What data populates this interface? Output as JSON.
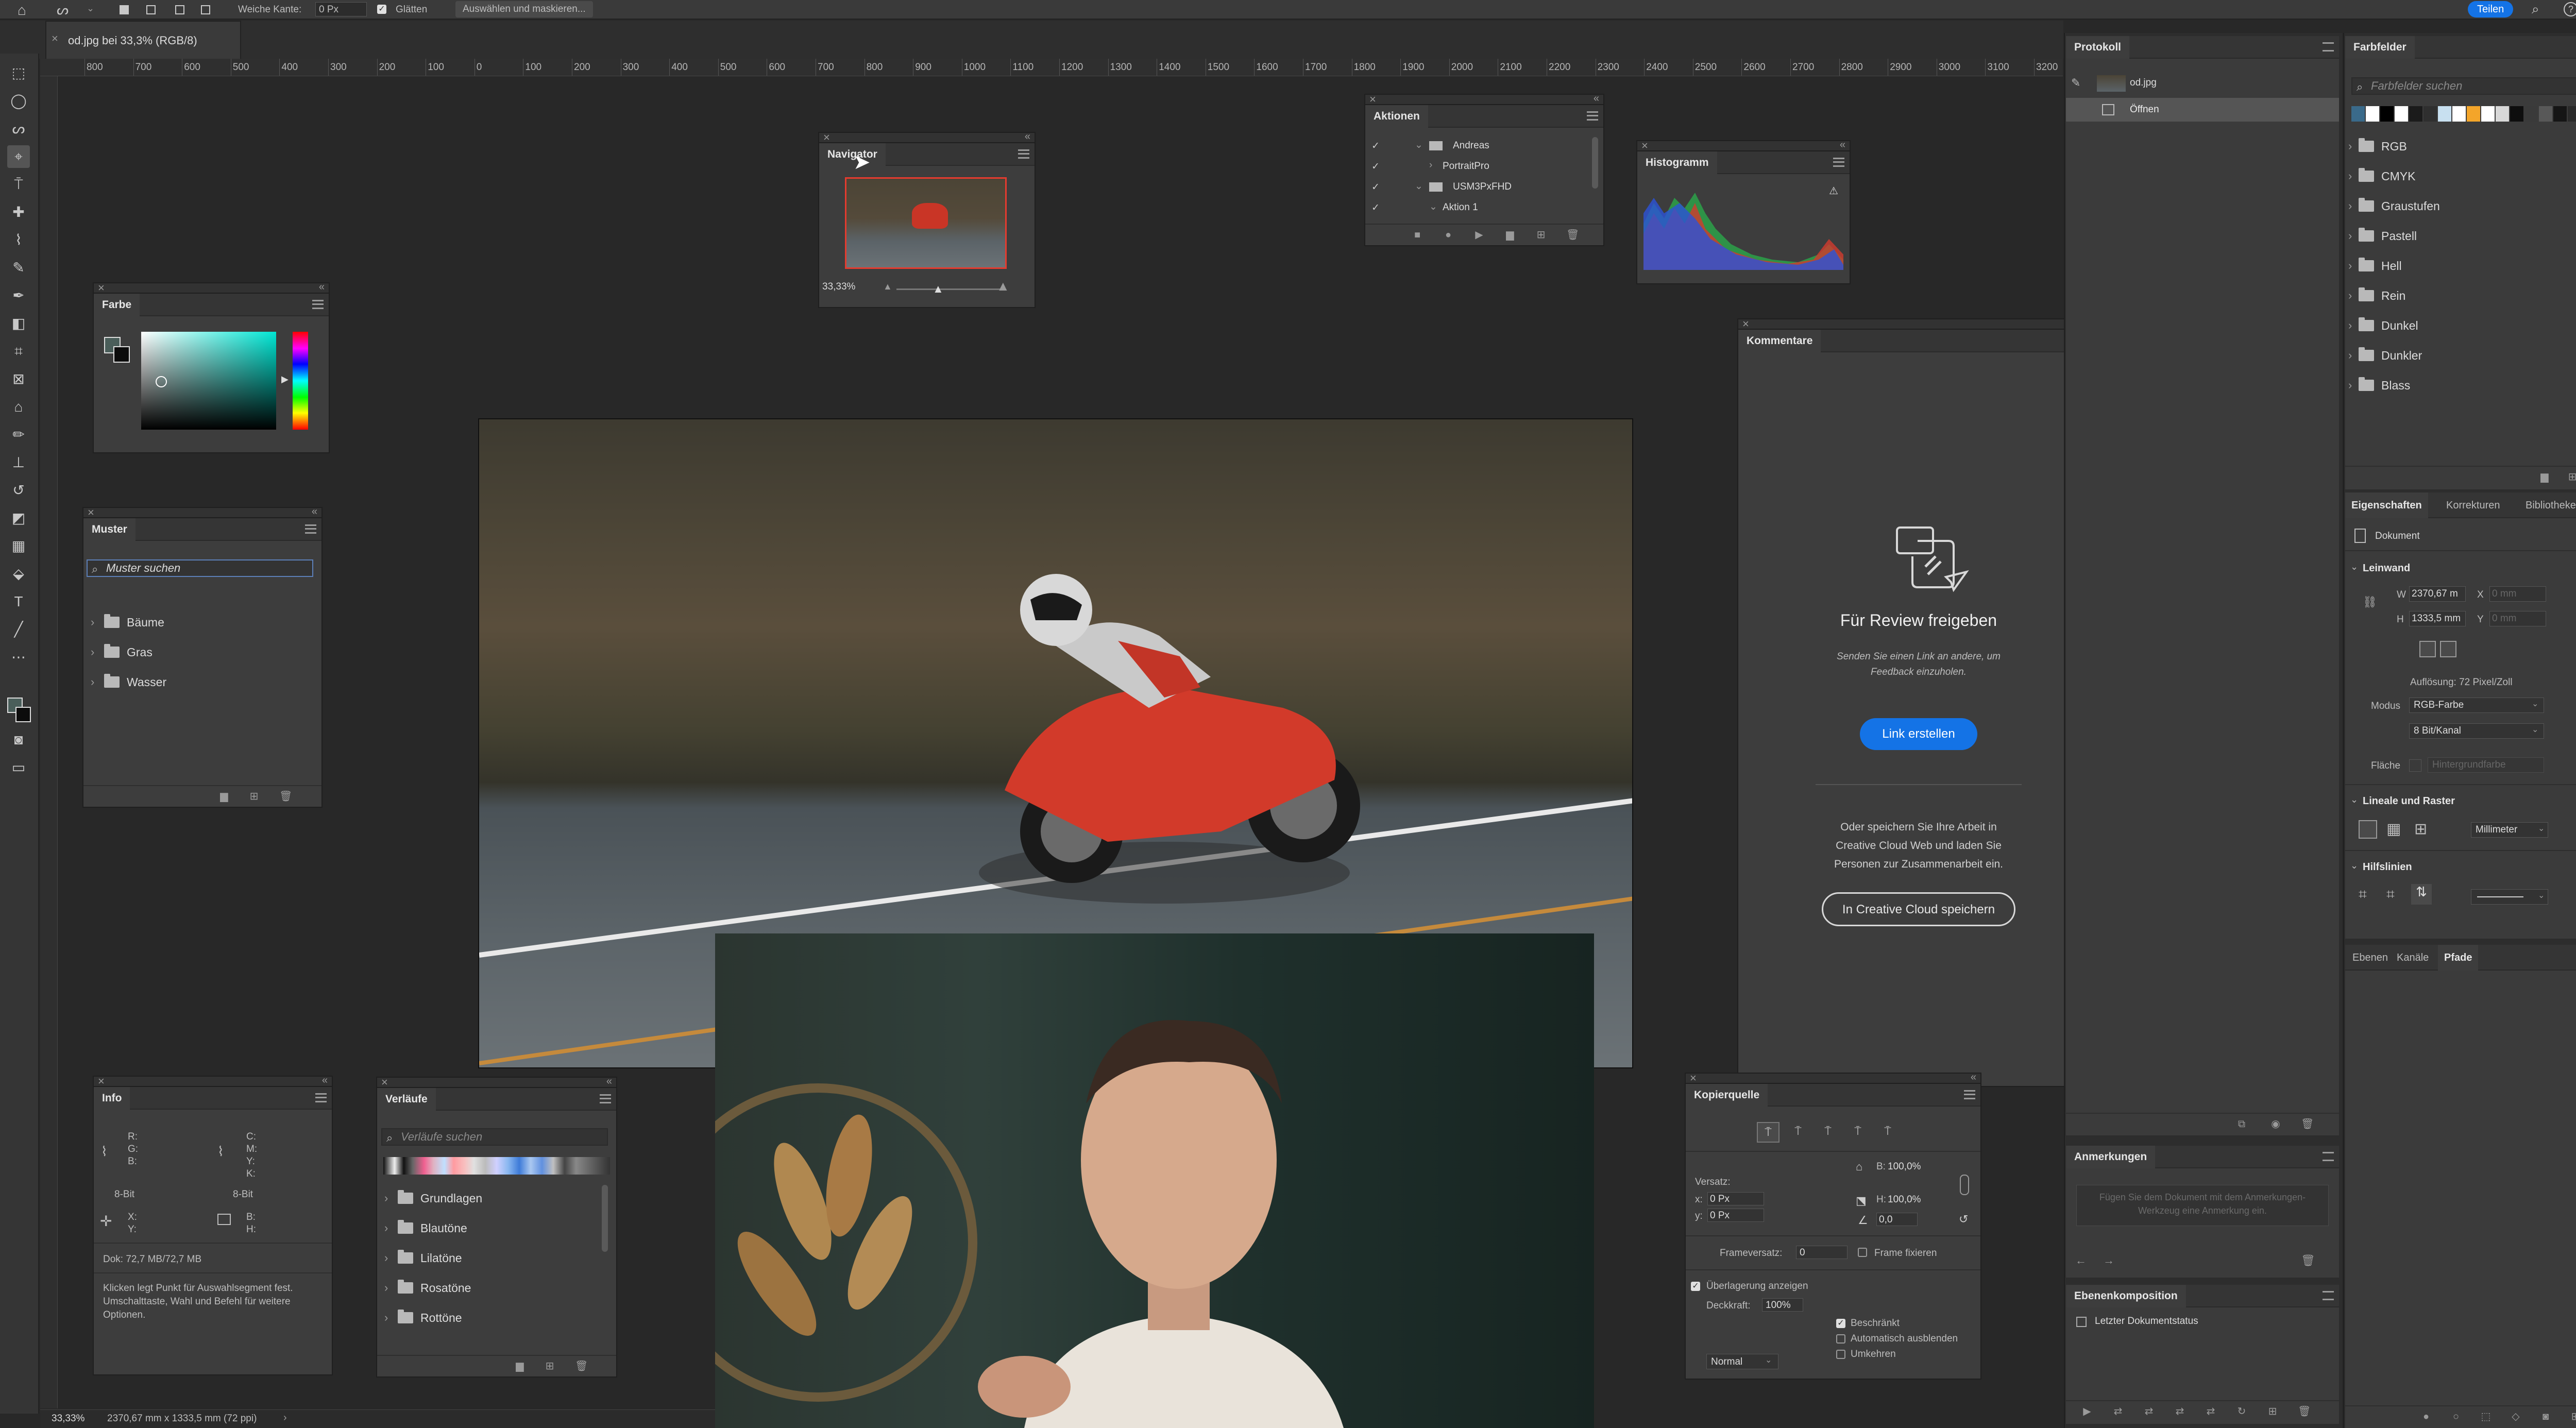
{
  "options_bar": {
    "feather_label": "Weiche Kante:",
    "feather_value": "0 Px",
    "smooth_label": "Glätten",
    "select_mask_button": "Auswählen und maskieren...",
    "share_button": "Teilen"
  },
  "document_tab": {
    "title": "od.jpg bei 33,3% (RGB/8)"
  },
  "ruler": {
    "ticks": [
      "800",
      "700",
      "600",
      "500",
      "400",
      "300",
      "200",
      "100",
      "0",
      "100",
      "200",
      "300",
      "400",
      "500",
      "600",
      "700",
      "800",
      "900",
      "1000",
      "1100",
      "1200",
      "1300",
      "1400",
      "1500",
      "1600",
      "1700",
      "1800",
      "1900",
      "2000",
      "2100",
      "2200",
      "2300",
      "2400",
      "2500",
      "2600",
      "2700",
      "2800",
      "2900",
      "3000",
      "3100",
      "3200"
    ]
  },
  "navigator": {
    "title": "Navigator",
    "zoom": "33,33%"
  },
  "actions": {
    "title": "Aktionen",
    "items": [
      "Andreas",
      "PortraitPro",
      "USM3PxFHD",
      "Aktion 1"
    ]
  },
  "histogram": {
    "title": "Histogramm"
  },
  "color_panel": {
    "title": "Farbe"
  },
  "patterns": {
    "title": "Muster",
    "search_placeholder": "Muster suchen",
    "folders": [
      "Bäume",
      "Gras",
      "Wasser"
    ]
  },
  "comments": {
    "title": "Kommentare",
    "heading": "Für Review freigeben",
    "description": "Senden Sie einen Link an andere, um Feedback einzuholen.",
    "create_link_button": "Link erstellen",
    "alt_text": "Oder speichern Sie Ihre Arbeit in Creative Cloud Web und laden Sie Personen zur Zusammenarbeit ein.",
    "save_cc_button": "In Creative Cloud speichern"
  },
  "info": {
    "title": "Info",
    "rgb": [
      "R:",
      "G:",
      "B:"
    ],
    "cmyk": [
      "C:",
      "M:",
      "Y:",
      "K:"
    ],
    "bit_left": "8-Bit",
    "bit_right": "8-Bit",
    "xy": [
      "X:",
      "Y:"
    ],
    "bh": [
      "B:",
      "H:"
    ],
    "doc": "Dok: 72,7 MB/72,7 MB",
    "hint": "Klicken legt Punkt für Auswahlsegment fest. Umschalttaste, Wahl und Befehl für weitere Optionen."
  },
  "gradients": {
    "title": "Verläufe",
    "search_placeholder": "Verläufe suchen",
    "folders": [
      "Grundlagen",
      "Blautöne",
      "Lilatöne",
      "Rosatöne",
      "Rottöne"
    ]
  },
  "clone_source": {
    "title": "Kopierquelle",
    "offset_label": "Versatz:",
    "x_value": "0 Px",
    "y_value": "0 Px",
    "w_value": "100,0%",
    "h_value": "100,0%",
    "angle_value": "0,0",
    "frame_offset_label": "Frameversatz:",
    "frame_offset_value": "0",
    "lock_frame_label": "Frame fixieren",
    "show_overlay_label": "Überlagerung anzeigen",
    "opacity_label": "Deckkraft:",
    "opacity_value": "100%",
    "blend_mode": "Normal",
    "clipped_label": "Beschränkt",
    "autohide_label": "Automatisch ausblenden",
    "invert_label": "Umkehren"
  },
  "protocol": {
    "title": "Protokoll",
    "snapshot": "od.jpg",
    "items": [
      "Öffnen"
    ]
  },
  "notes": {
    "title": "Anmerkungen",
    "placeholder": "Fügen Sie dem Dokument mit dem Anmerkungen-Werkzeug eine Anmerkung ein."
  },
  "layer_comps": {
    "title": "Ebenenkomposition",
    "item": "Letzter Dokumentstatus"
  },
  "swatches": {
    "title": "Farbfelder",
    "search_placeholder": "Farbfelder suchen",
    "colors": [
      "#ffffff",
      "#000000",
      "#ffffff",
      "#1b1b1b",
      "#2f2f2f",
      "#c8e0f0",
      "#ffffff",
      "#f3a52a",
      "#ffffff",
      "#d8d8d8",
      "#0e0e0e",
      "#3a3a3a",
      "#585858",
      "#151515",
      "#2a2a2a"
    ],
    "folders": [
      "RGB",
      "CMYK",
      "Graustufen",
      "Pastell",
      "Hell",
      "Rein",
      "Dunkel",
      "Dunkler",
      "Blass"
    ]
  },
  "properties": {
    "tabs": [
      "Eigenschaften",
      "Korrekturen",
      "Bibliotheken"
    ],
    "doc_label": "Dokument",
    "canvas_section": "Leinwand",
    "w_label": "W",
    "w_value": "2370,67 m",
    "h_label": "H",
    "h_value": "1333,5 mm",
    "x_label": "X",
    "y_label": "Y",
    "x_placeholder": "0 mm",
    "y_placeholder": "0 mm",
    "resolution": "Auflösung: 72 Pixel/Zoll",
    "mode_label": "Modus",
    "mode_value": "RGB-Farbe",
    "depth_value": "8 Bit/Kanal",
    "fill_label": "Fläche",
    "fill_value": "Hintergrundfarbe",
    "rulers_section": "Lineale und Raster",
    "units_value": "Millimeter",
    "guides_section": "Hilfslinien"
  },
  "layers": {
    "tabs": [
      "Ebenen",
      "Kanäle",
      "Pfade"
    ]
  },
  "status": {
    "zoom": "33,33%",
    "dims": "2370,67 mm x 1333,5 mm (72 ppi)"
  }
}
